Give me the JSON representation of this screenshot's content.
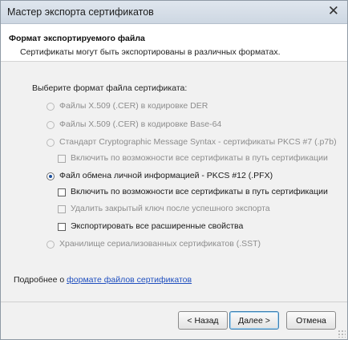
{
  "window": {
    "title": "Мастер экспорта сертификатов",
    "close_glyph": "✕"
  },
  "header": {
    "title": "Формат экспортируемого файла",
    "subtitle": "Сертификаты могут быть экспортированы в различных форматах."
  },
  "prompt": "Выберите формат файла сертификата:",
  "options": {
    "der": {
      "label": "Файлы X.509 (.CER) в кодировке DER",
      "enabled": false,
      "checked": false
    },
    "base64": {
      "label": "Файлы X.509 (.CER) в кодировке Base-64",
      "enabled": false,
      "checked": false
    },
    "p7b": {
      "label": "Стандарт Cryptographic Message Syntax - сертификаты PKCS #7 (.p7b)",
      "enabled": false,
      "checked": false
    },
    "p7b_include": {
      "label": "Включить по возможности все сертификаты в путь сертификации",
      "enabled": false,
      "checked": false
    },
    "pfx": {
      "label": "Файл обмена личной информацией - PKCS #12 (.PFX)",
      "enabled": true,
      "checked": true
    },
    "pfx_include": {
      "label": "Включить по возможности все сертификаты в путь сертификации",
      "enabled": true,
      "checked": false
    },
    "pfx_delete_key": {
      "label": "Удалить закрытый ключ после успешного экспорта",
      "enabled": false,
      "checked": false
    },
    "pfx_export_ext": {
      "label": "Экспортировать все расширенные свойства",
      "enabled": true,
      "checked": false
    },
    "sst": {
      "label": "Хранилище сериализованных сертификатов (.SST)",
      "enabled": false,
      "checked": false
    }
  },
  "more_info": {
    "prefix": "Подробнее о",
    "link": "формате файлов сертификатов"
  },
  "buttons": {
    "back": "< Назад",
    "next": "Далее >",
    "cancel": "Отмена"
  }
}
